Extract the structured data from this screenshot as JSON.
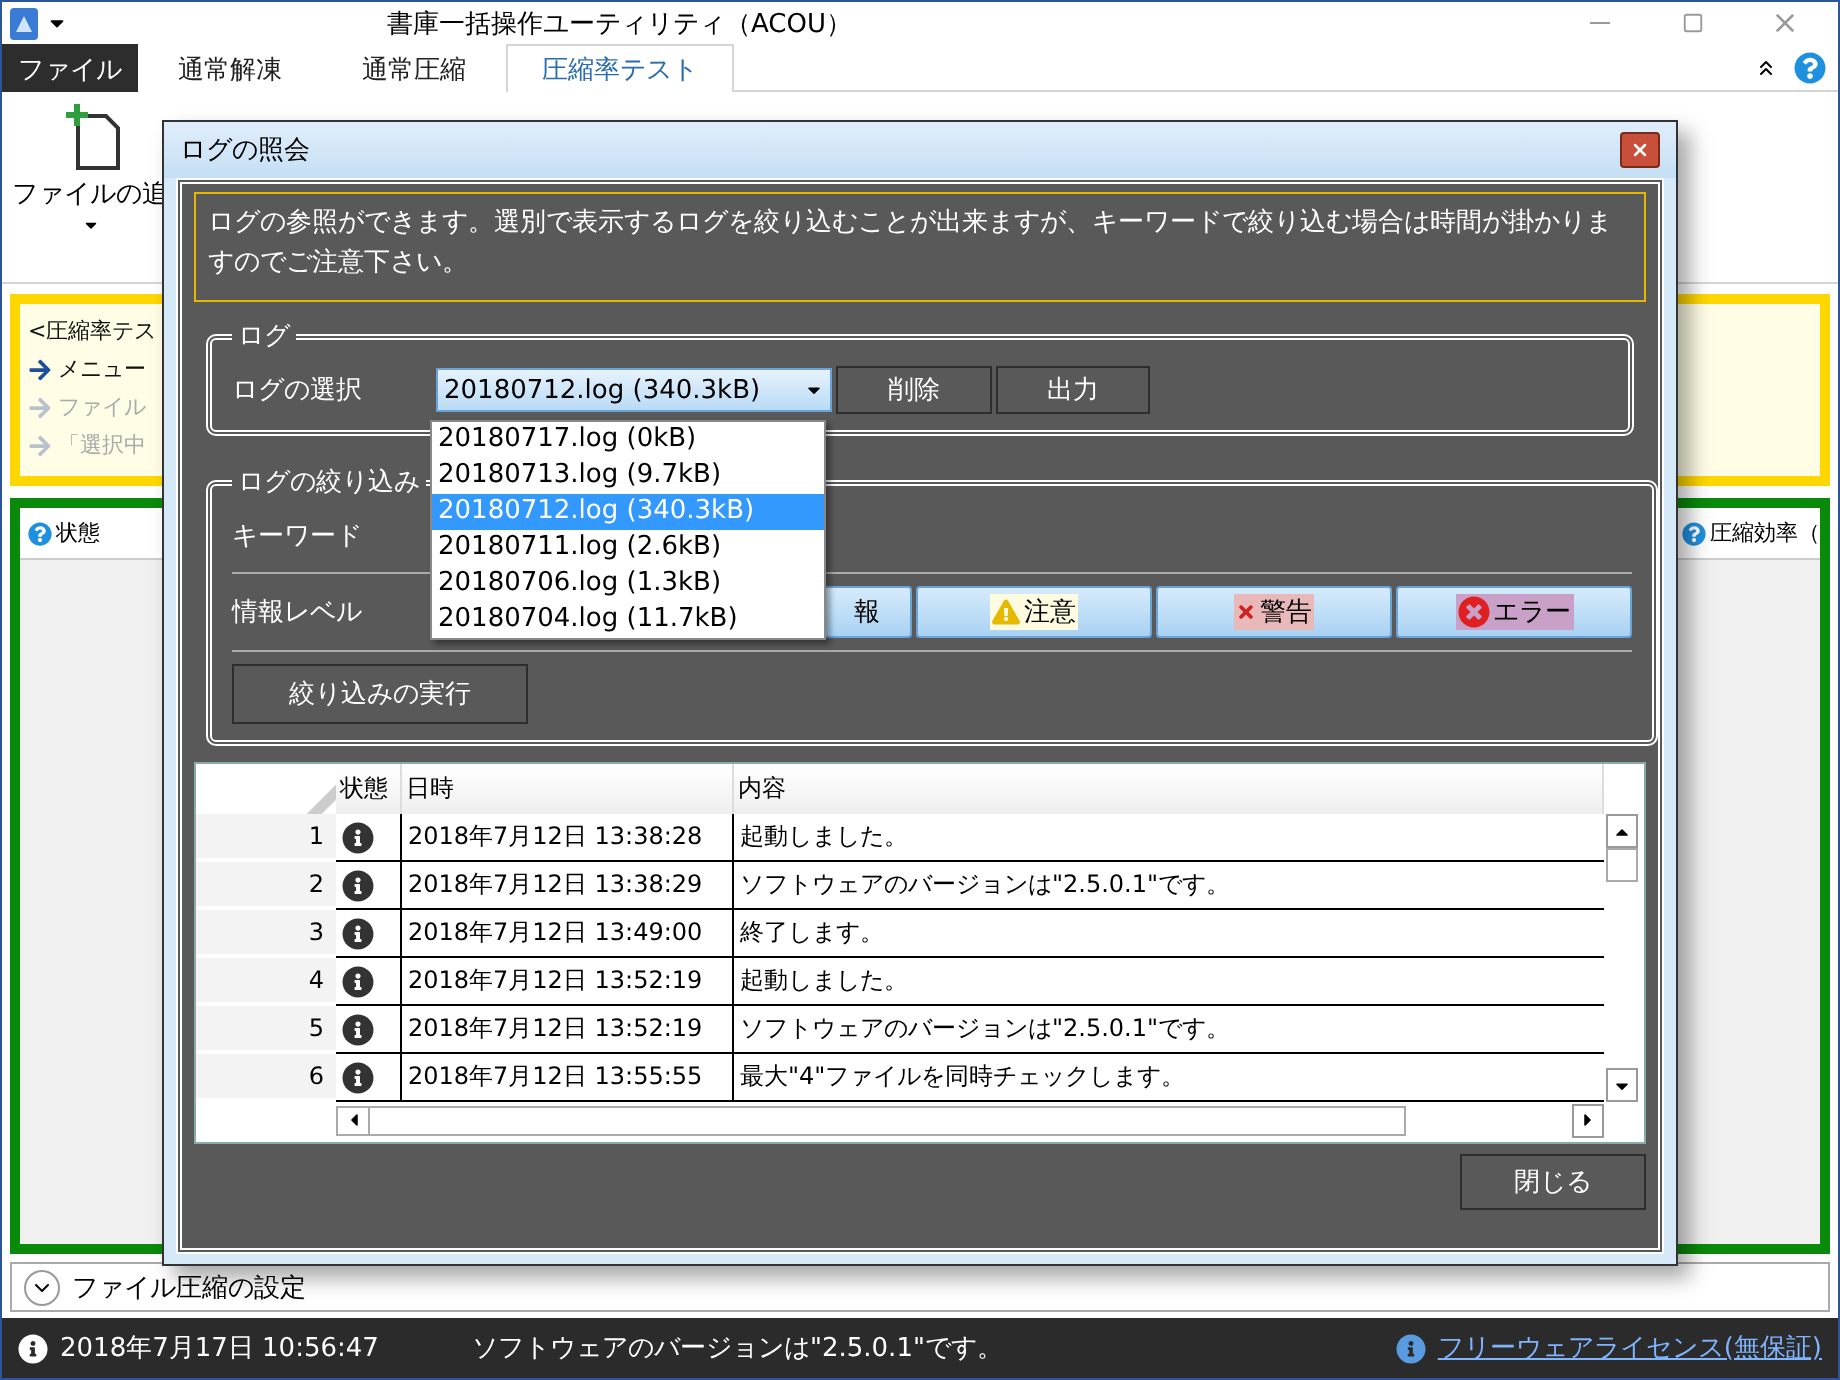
{
  "window": {
    "title": "書庫一括操作ユーティリティ（ACOU）"
  },
  "ribbon": {
    "tabs": [
      {
        "label": "ファイル",
        "kind": "file",
        "selected": false
      },
      {
        "label": "通常解凍",
        "kind": "tab",
        "selected": false
      },
      {
        "label": "通常圧縮",
        "kind": "tab",
        "selected": false
      },
      {
        "label": "圧縮率テスト",
        "kind": "tab",
        "selected": true
      }
    ],
    "command": "ファイルの追"
  },
  "guide_panel": {
    "heading": "<圧縮率テス",
    "steps": [
      {
        "label": "メニュー",
        "active": true
      },
      {
        "label": "ファイル",
        "active": false
      },
      {
        "label": "「選択中",
        "active": false
      }
    ]
  },
  "result_table": {
    "columns": [
      "状態",
      "圧縮効率（"
    ]
  },
  "settings_expander": {
    "label": "ファイル圧縮の設定",
    "expanded": false
  },
  "status_bar": {
    "time": "2018年7月17日 10:56:47",
    "message": "ソフトウェアのバージョンは\"2.5.0.1\"です。",
    "link": "フリーウェアライセンス(無保証)"
  },
  "dialog": {
    "title": "ログの照会",
    "description": "ログの参照ができます。選別で表示するログを絞り込むことが出来ますが、キーワードで絞り込む場合は時間が掛かりますのでご注意下さい。",
    "log_group": {
      "title": "ログ",
      "label": "ログの選択",
      "selected_log": "20180712.log (340.3kB)",
      "buttons": [
        "削除",
        "出力"
      ],
      "options": [
        {
          "label": "20180717.log (0kB)",
          "selected": false
        },
        {
          "label": "20180713.log (9.7kB)",
          "selected": false
        },
        {
          "label": "20180712.log (340.3kB)",
          "selected": true
        },
        {
          "label": "20180711.log (2.6kB)",
          "selected": false
        },
        {
          "label": "20180706.log (1.3kB)",
          "selected": false
        },
        {
          "label": "20180704.log (11.7kB)",
          "selected": false
        }
      ]
    },
    "filter_group": {
      "title": "ログの絞り込み",
      "keyword_label": "キーワード",
      "level_label": "情報レベル",
      "levels": [
        {
          "label": "報",
          "kind": "info"
        },
        {
          "label": "注意",
          "kind": "warning"
        },
        {
          "label": "警告",
          "kind": "alert"
        },
        {
          "label": "エラー",
          "kind": "error"
        }
      ],
      "run_button": "絞り込みの実行"
    },
    "table": {
      "columns": [
        "状態",
        "日時",
        "内容"
      ],
      "rows": [
        {
          "index": "1",
          "kind": "info",
          "time": "2018年7月12日 13:38:28",
          "content": "起動しました。"
        },
        {
          "index": "2",
          "kind": "info",
          "time": "2018年7月12日 13:38:29",
          "content": "ソフトウェアのバージョンは\"2.5.0.1\"です。"
        },
        {
          "index": "3",
          "kind": "info",
          "time": "2018年7月12日 13:49:00",
          "content": "終了します。"
        },
        {
          "index": "4",
          "kind": "info",
          "time": "2018年7月12日 13:52:19",
          "content": "起動しました。"
        },
        {
          "index": "5",
          "kind": "info",
          "time": "2018年7月12日 13:52:19",
          "content": "ソフトウェアのバージョンは\"2.5.0.1\"です。"
        },
        {
          "index": "6",
          "kind": "info",
          "time": "2018年7月12日 13:55:55",
          "content": "最大\"4\"ファイルを同時チェックします。"
        }
      ]
    },
    "close_button": "閉じる"
  }
}
